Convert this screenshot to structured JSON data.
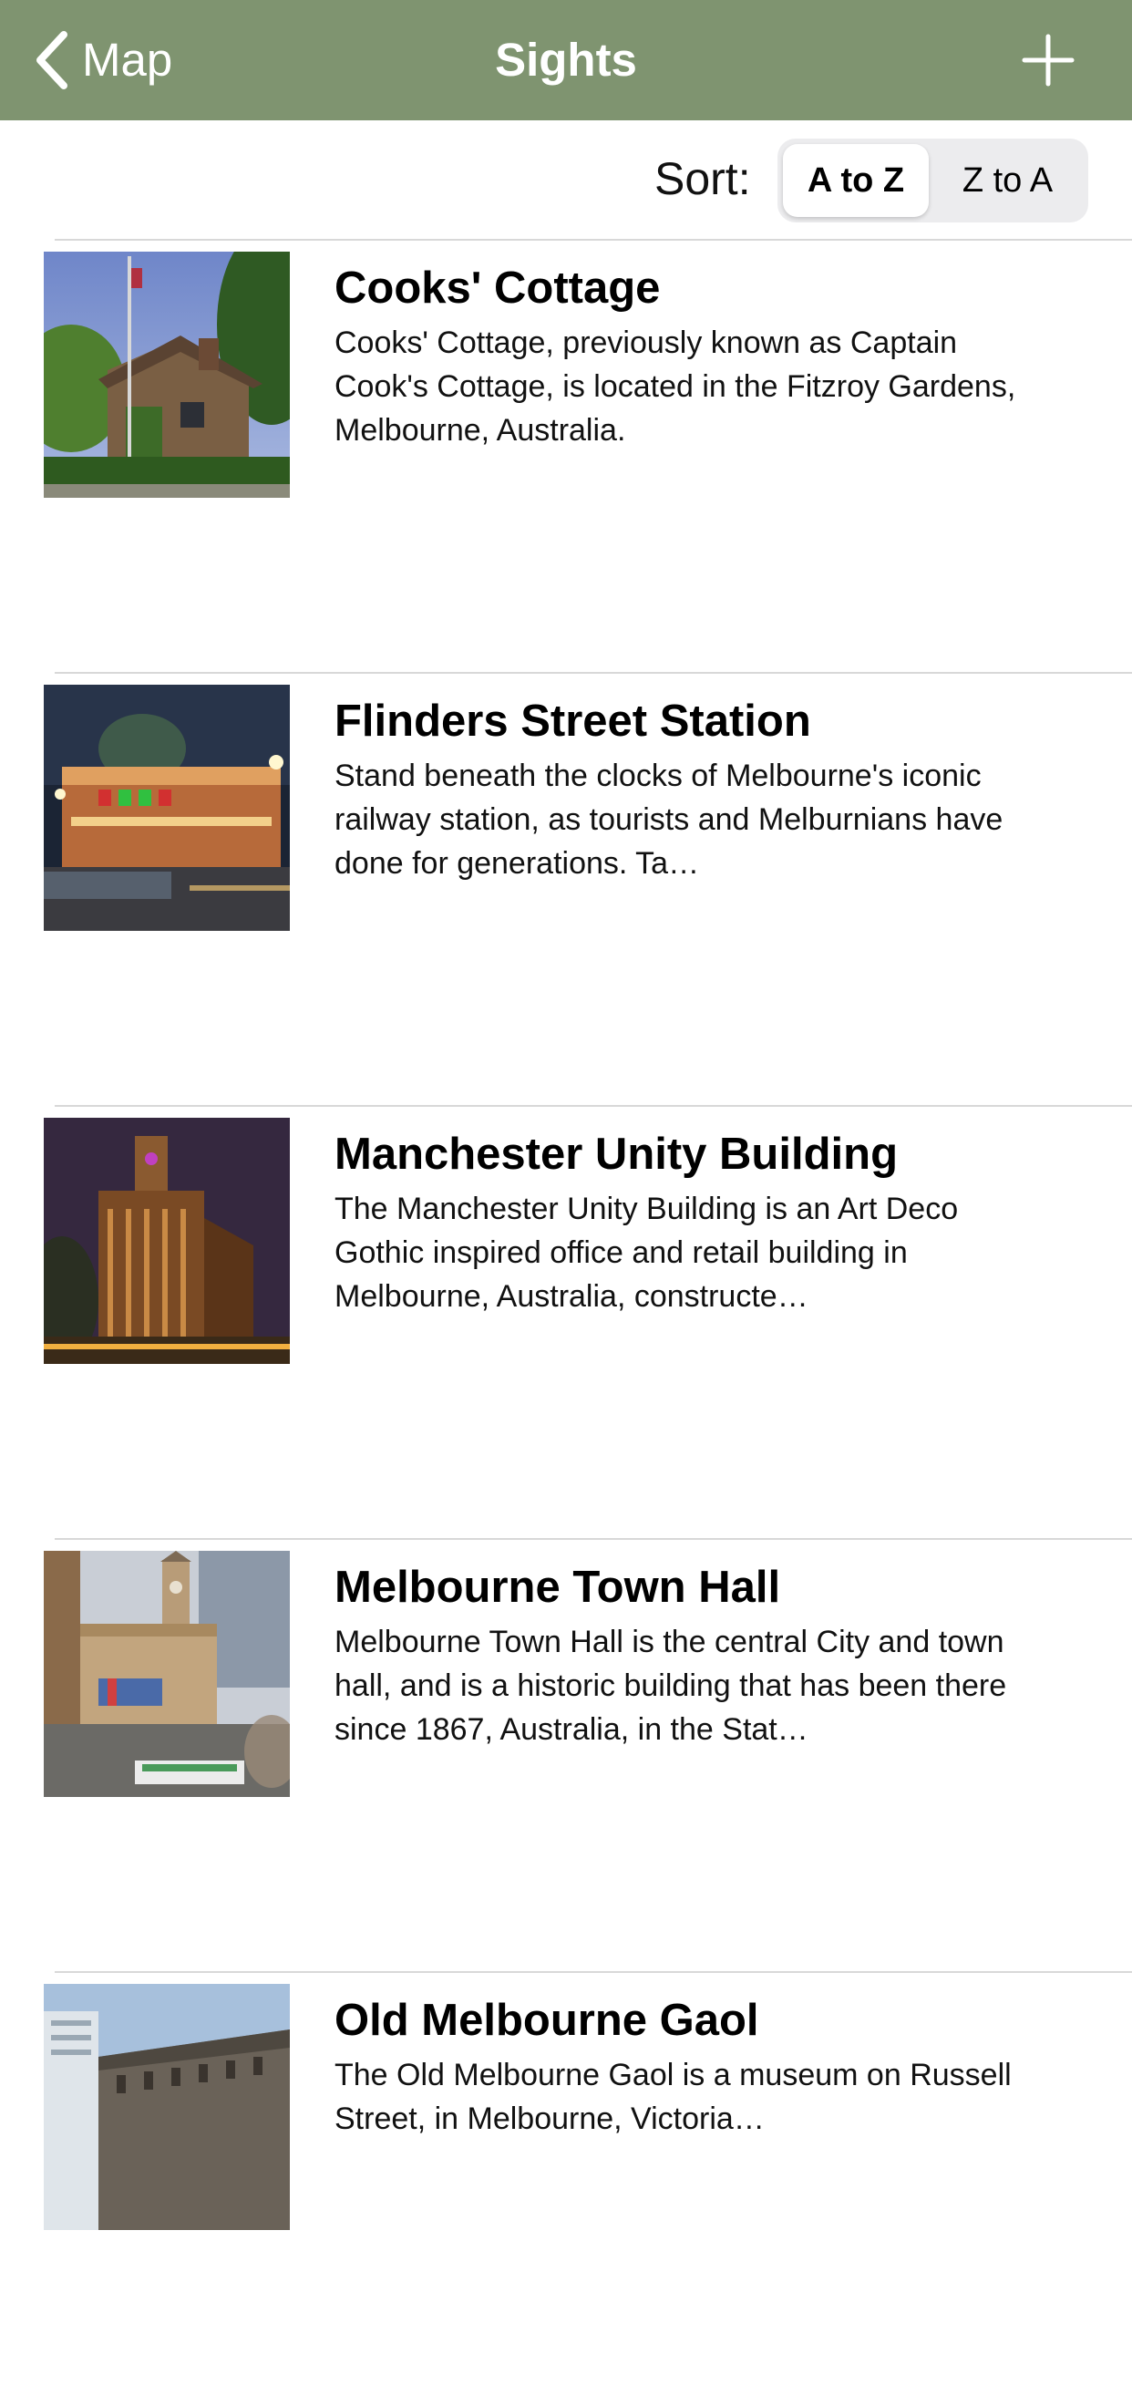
{
  "nav": {
    "back_label": "Map",
    "back_icon": "chevron-left-icon",
    "title": "Sights",
    "add_icon": "plus-icon"
  },
  "colors": {
    "nav_background": "#7f9470",
    "nav_text": "#ffffff"
  },
  "sort": {
    "label": "Sort:",
    "options": [
      "A to Z",
      "Z to A"
    ],
    "selected": "A to Z"
  },
  "sights": [
    {
      "title": "Cooks' Cottage",
      "description": "Cooks' Cottage, previously known as Captain Cook's Cottage, is located in the Fitzroy Gardens, Melbourne, Australia."
    },
    {
      "title": "Flinders Street Station",
      "description": "Stand beneath the clocks of Melbourne's iconic railway station, as tourists and Melburnians have done for generations. Ta…"
    },
    {
      "title": "Manchester Unity Building",
      "description": "The Manchester Unity Building is an Art Deco Gothic inspired office and retail building in Melbourne, Australia, constructe…"
    },
    {
      "title": "Melbourne Town Hall",
      "description": "Melbourne Town Hall is the central City and town hall, and is a historic building that has been there since 1867, Australia, in the Stat…"
    },
    {
      "title": "Old Melbourne Gaol",
      "description": "The Old Melbourne Gaol is a museum on Russell Street, in Melbourne, Victoria…"
    }
  ]
}
